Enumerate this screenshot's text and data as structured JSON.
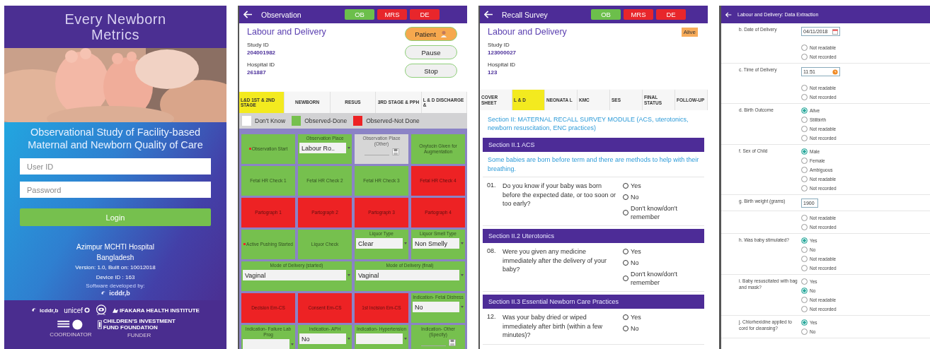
{
  "login": {
    "title": "Every Newborn Metrics",
    "tagline": [
      "Observational Study of Facility-based",
      "Maternal and Newborn Quality of Care"
    ],
    "user_id": {
      "placeholder": "User ID"
    },
    "password": {
      "placeholder": "Password"
    },
    "login_button": "Login",
    "hospital": "Azimpur MCHTI Hospital",
    "country": "Bangladesh",
    "version": "Version: 1.0, Built on: 10012018",
    "device": "Device ID : 163",
    "developer_note": "Software developed by:",
    "developer": "icddr,b",
    "partners": [
      "icddr,b",
      "unicef",
      "IFAKARA HEALTH INSTITUTE",
      "CHILDREN'S INVESTMENT FUND FOUNDATION"
    ],
    "roles": [
      "COORDINATOR",
      "FUNDER"
    ]
  },
  "observation": {
    "header": {
      "title": "Observation",
      "badges": [
        {
          "label": "OB",
          "color": "#6cbf4b"
        },
        {
          "label": "MRS",
          "color": "#e8262b"
        },
        {
          "label": "DE",
          "color": "#e8262b"
        }
      ]
    },
    "heading": "Labour and Delivery",
    "study_id_label": "Study ID",
    "study_id": "204001982",
    "hospital_id_label": "Hospital ID",
    "hospital_id": "261887",
    "buttons": [
      {
        "label": "Patient",
        "kind": "patient"
      },
      {
        "label": "Pause",
        "kind": "outline"
      },
      {
        "label": "Stop",
        "kind": "outline"
      }
    ],
    "tabs": [
      {
        "label": "L&D 1ST & 2ND STAGE",
        "selected": true
      },
      {
        "label": "NEWBORN",
        "selected": false
      },
      {
        "label": "RESUS",
        "selected": false
      },
      {
        "label": "3RD STAGE & PPH",
        "selected": false
      },
      {
        "label": "L & D DISCHARGE &",
        "selected": false
      }
    ],
    "legend": [
      {
        "label": "Don't Know",
        "color": "#ffffff"
      },
      {
        "label": "Observed-Done",
        "color": "#76c04e"
      },
      {
        "label": "Observed-Not Done",
        "color": "#ed2224"
      }
    ],
    "tiles": [
      {
        "label": "Observation Start",
        "color": "#76c04e",
        "required": true,
        "kind": "plain"
      },
      {
        "label": "Observation Place",
        "color": "#76c04e",
        "kind": "dropdown",
        "value": "Labour Ro.."
      },
      {
        "label": "Observation Place (Other)",
        "color": "#d6d6d6",
        "kind": "text"
      },
      {
        "label": "Oxytocin Given for Augmentation",
        "color": "#76c04e",
        "kind": "plain"
      },
      {
        "label": "Fetal HR Check 1",
        "color": "#76c04e",
        "kind": "plain"
      },
      {
        "label": "Fetal HR Check 2",
        "color": "#76c04e",
        "kind": "plain"
      },
      {
        "label": "Fetal HR Check 3",
        "color": "#76c04e",
        "kind": "plain"
      },
      {
        "label": "Fetal HR Check 4",
        "color": "#ed2224",
        "kind": "plain"
      },
      {
        "label": "Partograph 1",
        "color": "#ed2224",
        "kind": "plain"
      },
      {
        "label": "Partograph 2",
        "color": "#ed2224",
        "kind": "plain"
      },
      {
        "label": "Partograph 3",
        "color": "#ed2224",
        "kind": "plain"
      },
      {
        "label": "Partograph 4",
        "color": "#ed2224",
        "kind": "plain"
      },
      {
        "label": "Active Pushing Started",
        "color": "#76c04e",
        "required": true,
        "kind": "plain"
      },
      {
        "label": "Liquor Check",
        "color": "#76c04e",
        "kind": "plain"
      },
      {
        "label": "Liquor Type",
        "color": "#76c04e",
        "kind": "dropdown",
        "value": "Clear"
      },
      {
        "label": "Liquor Smell Type",
        "color": "#76c04e",
        "kind": "dropdown",
        "value": "Non Smelly"
      },
      {
        "label": "Mode of Delivery (started)",
        "color": "#76c04e",
        "kind": "wide-dropdown",
        "value": "Vaginal"
      },
      {
        "label": "Mode of Delivery (final)",
        "color": "#76c04e",
        "kind": "wide-dropdown",
        "value": "Vaginal"
      },
      {
        "label": "Decision Em-CS",
        "color": "#ed2224",
        "kind": "plain"
      },
      {
        "label": "Consent Em-CS",
        "color": "#ed2224",
        "kind": "plain"
      },
      {
        "label": "1st Incision Em-CS",
        "color": "#ed2224",
        "kind": "plain"
      },
      {
        "label": "Indication- Fetal Distress",
        "color": "#76c04e",
        "kind": "dropdown",
        "value": "No"
      },
      {
        "label": "Indication- Failure Lab Prog",
        "color": "#76c04e",
        "kind": "dropdown"
      },
      {
        "label": "Indication- APH",
        "color": "#76c04e",
        "kind": "dropdown",
        "value": "No"
      },
      {
        "label": "Indication- Hypertension",
        "color": "#76c04e",
        "kind": "dropdown"
      },
      {
        "label": "Indication- Other (Specify)",
        "color": "#76c04e",
        "kind": "text"
      }
    ]
  },
  "recall": {
    "header": {
      "title": "Recall Survey",
      "badges": [
        {
          "label": "OB",
          "color": "#6cbf4b"
        },
        {
          "label": "MRS",
          "color": "#e8262b"
        },
        {
          "label": "DE",
          "color": "#e8262b"
        }
      ]
    },
    "heading": "Labour and Delivery",
    "status_badge": "Alive",
    "study_id_label": "Study ID",
    "study_id": "123000027",
    "hospital_id_label": "Hospital ID",
    "hospital_id": "123",
    "tabs": [
      {
        "label": "COVER SHEET",
        "selected": false
      },
      {
        "label": "L & D",
        "selected": true
      },
      {
        "label": "NEONATA L",
        "selected": false
      },
      {
        "label": "KMC",
        "selected": false
      },
      {
        "label": "SES",
        "selected": false
      },
      {
        "label": "FINAL STATUS",
        "selected": false
      },
      {
        "label": "FOLLOW-UP",
        "selected": false
      }
    ],
    "module_title": "Section II: MATERNAL RECALL SURVEY MODULE (ACS, uterotonics, newborn resuscitation, ENC practices)",
    "sections": [
      {
        "title": "Section II.1 ACS",
        "intro": "Some babies are born before term and there are methods to help with their breathing.",
        "questions": [
          {
            "number": "01.",
            "text": "Do you know if your baby was born before the expected date, or too soon or too early?",
            "options": [
              {
                "label": "Yes",
                "selected": false
              },
              {
                "label": "No",
                "selected": false
              },
              {
                "label": "Don't know/don't remember",
                "selected": false
              }
            ]
          }
        ]
      },
      {
        "title": "Section II.2 Uterotonics",
        "questions": [
          {
            "number": "08.",
            "text": "Were you given any medicine immediately after the delivery of your baby?",
            "options": [
              {
                "label": "Yes",
                "selected": false
              },
              {
                "label": "No",
                "selected": false
              },
              {
                "label": "Don't know/don't remember",
                "selected": false
              }
            ]
          }
        ]
      },
      {
        "title": "Section II.3 Essential Newborn Care Practices",
        "questions": [
          {
            "number": "12.",
            "text": "Was your baby dried or wiped immediately after birth (within a few minutes)?",
            "options": [
              {
                "label": "Yes",
                "selected": false
              },
              {
                "label": "No",
                "selected": false
              }
            ]
          }
        ]
      }
    ]
  },
  "extraction": {
    "header": {
      "title": "Labour and Delivery: Data Extraction"
    },
    "rows": [
      {
        "label": "b. Date of Delivery",
        "input": {
          "kind": "date",
          "value": "04/11/2018"
        },
        "options": [
          {
            "label": "Not readable",
            "selected": false
          },
          {
            "label": "Not recorded",
            "selected": false
          }
        ]
      },
      {
        "label": "c. Time of Delivery",
        "input": {
          "kind": "time",
          "value": "11:51"
        },
        "options": [
          {
            "label": "Not readable",
            "selected": false
          },
          {
            "label": "Not recorded",
            "selected": false
          }
        ]
      },
      {
        "label": "d. Birth Outcome",
        "options": [
          {
            "label": "Alive",
            "selected": true
          },
          {
            "label": "Stillbirth",
            "selected": false
          },
          {
            "label": "Not readable",
            "selected": false
          },
          {
            "label": "Not recorded",
            "selected": false
          }
        ]
      },
      {
        "label": "f. Sex of Child",
        "options": [
          {
            "label": "Male",
            "selected": true
          },
          {
            "label": "Female",
            "selected": false
          },
          {
            "label": "Ambiguous",
            "selected": false
          },
          {
            "label": "Not readable",
            "selected": false
          },
          {
            "label": "Not recorded",
            "selected": false
          }
        ]
      },
      {
        "label": "g. Birth weight (grams)",
        "input": {
          "kind": "number",
          "value": "1900"
        }
      },
      {
        "options": [
          {
            "label": "Not readable",
            "selected": false
          },
          {
            "label": "Not recorded",
            "selected": false
          }
        ]
      },
      {
        "label": "h. Was baby stimulated?",
        "options": [
          {
            "label": "Yes",
            "selected": true
          },
          {
            "label": "No",
            "selected": false
          },
          {
            "label": "Not readable",
            "selected": false
          },
          {
            "label": "Not recorded",
            "selected": false
          }
        ]
      },
      {
        "label": "i. Baby resuscitated with bag and mask?",
        "options": [
          {
            "label": "Yes",
            "selected": false
          },
          {
            "label": "No",
            "selected": true
          },
          {
            "label": "Not readable",
            "selected": false
          },
          {
            "label": "Not recorded",
            "selected": false
          }
        ]
      },
      {
        "label": "j. Chlorhexidine applied to cord for cleansing?",
        "options": [
          {
            "label": "Yes",
            "selected": true
          },
          {
            "label": "No",
            "selected": false
          }
        ]
      }
    ]
  }
}
